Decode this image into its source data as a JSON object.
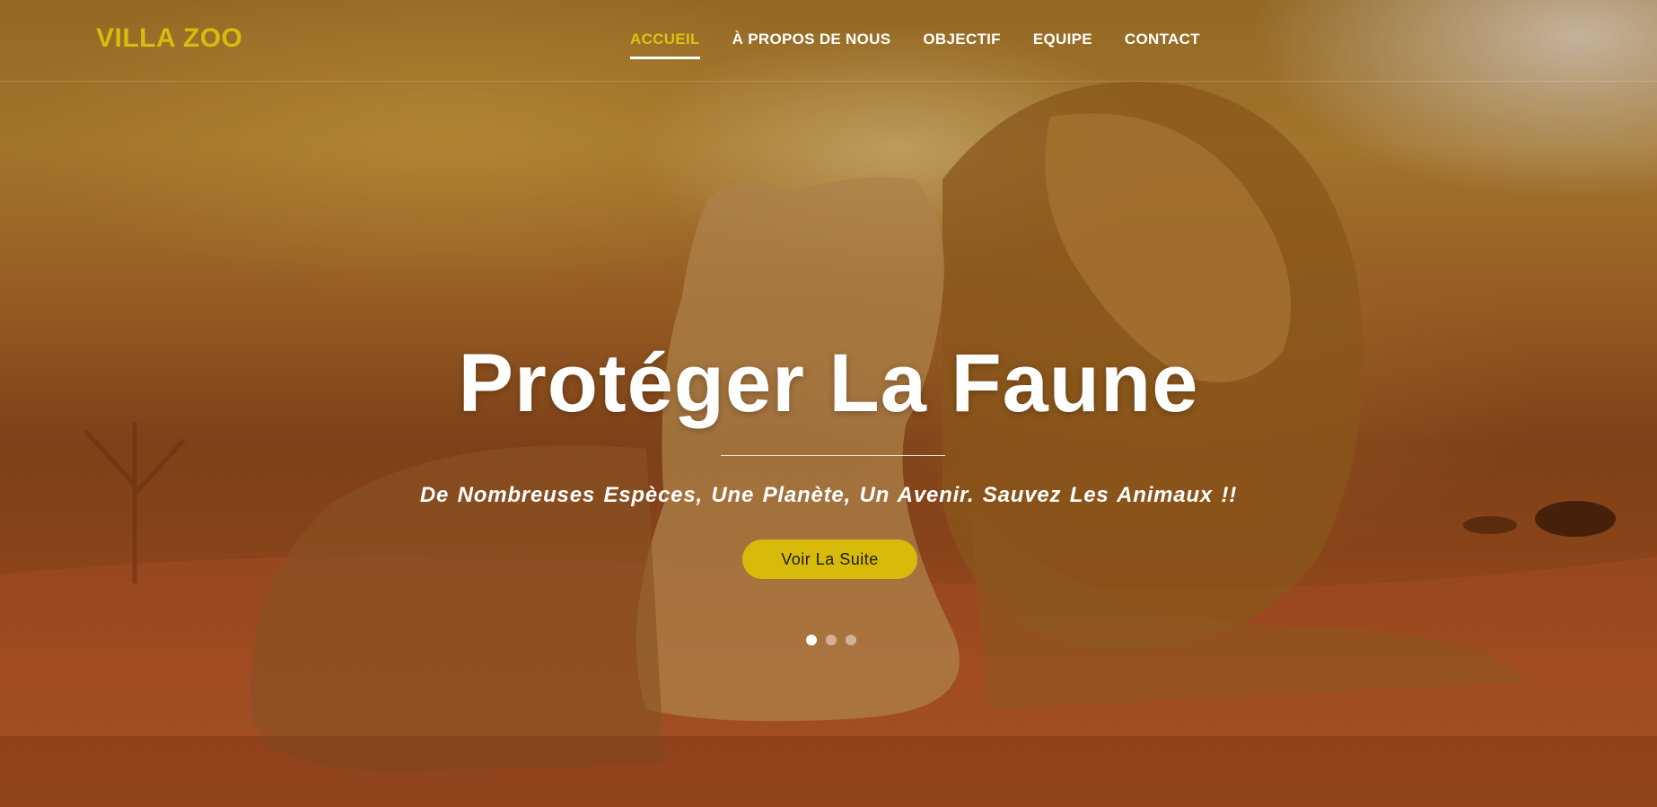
{
  "header": {
    "logo": "VILLA ZOO",
    "nav": [
      {
        "label": "ACCUEIL",
        "active": true
      },
      {
        "label": "À PROPOS DE NOUS",
        "active": false
      },
      {
        "label": "OBJECTIF",
        "active": false
      },
      {
        "label": "EQUIPE",
        "active": false
      },
      {
        "label": "CONTACT",
        "active": false
      }
    ]
  },
  "hero": {
    "title": "Protéger La Faune",
    "subtitle": "De Nombreuses Espèces, Une Planète, Un Avenir. Sauvez Les Animaux !!",
    "button_label": "Voir La Suite",
    "slides": 3,
    "active_slide": 1
  },
  "colors": {
    "accent": "#d8bb0a",
    "text": "#ffffff"
  }
}
